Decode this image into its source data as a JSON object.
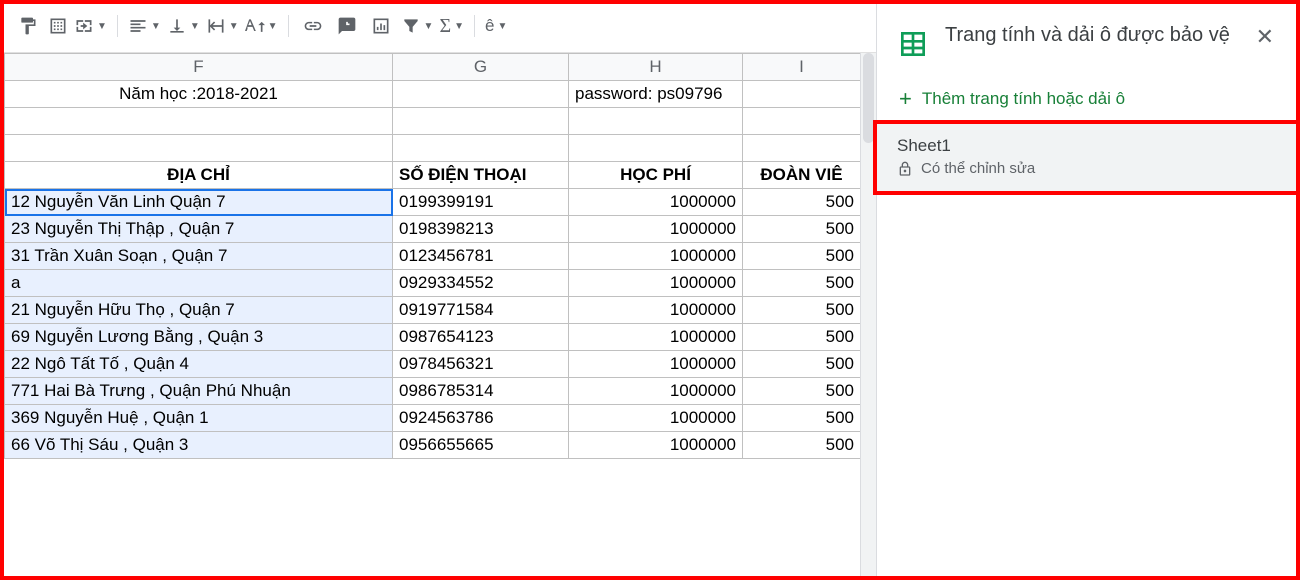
{
  "toolbar": {
    "paint_format": "paint-format",
    "borders": "borders",
    "merge": "merge",
    "h_align": "align-left",
    "v_align": "align-bottom",
    "wrap": "wrap-overflow",
    "rotate": "text-rotation",
    "link": "link",
    "comment": "comment",
    "chart": "chart",
    "filter": "filter",
    "functions": "functions",
    "language_letter": "ê"
  },
  "column_headers": [
    "F",
    "G",
    "H",
    "I"
  ],
  "header_rows": {
    "row1": {
      "f": "Năm học :2018-2021",
      "h": "password: ps09796"
    },
    "headers": {
      "f": "ĐỊA CHỈ",
      "g": "SỐ ĐIỆN THOẠI",
      "h": "HỌC PHÍ",
      "i": "ĐOÀN VIÊ"
    }
  },
  "rows": [
    {
      "f": "12 Nguyễn Văn Linh Quận 7",
      "g": "0199399191",
      "h": "1000000",
      "i": "500"
    },
    {
      "f": "23 Nguyễn Thị Thập , Quận 7",
      "g": "0198398213",
      "h": "1000000",
      "i": "500"
    },
    {
      "f": "31 Trần Xuân Soạn , Quận 7",
      "g": "0123456781",
      "h": "1000000",
      "i": "500"
    },
    {
      "f": "a",
      "g": "0929334552",
      "h": "1000000",
      "i": "500"
    },
    {
      "f": "21 Nguyễn Hữu Thọ , Quận 7",
      "g": "0919771584",
      "h": "1000000",
      "i": "500"
    },
    {
      "f": "69 Nguyễn Lương Bằng , Quận 3",
      "g": "0987654123",
      "h": "1000000",
      "i": "500"
    },
    {
      "f": "22 Ngô Tất Tố , Quận 4",
      "g": "0978456321",
      "h": "1000000",
      "i": "500"
    },
    {
      "f": "771 Hai Bà Trưng , Quận Phú Nhuận",
      "g": "0986785314",
      "h": "1000000",
      "i": "500"
    },
    {
      "f": "369 Nguyễn Huệ , Quận 1",
      "g": "0924563786",
      "h": "1000000",
      "i": "500"
    },
    {
      "f": "66 Võ Thị Sáu , Quận 3",
      "g": "0956655665",
      "h": "1000000",
      "i": "500"
    }
  ],
  "sidepanel": {
    "title": "Trang tính và dải ô được bảo vệ",
    "add_label": "Thêm trang tính hoặc dải ô",
    "item": {
      "name": "Sheet1",
      "permission": "Có thể chỉnh sửa"
    }
  }
}
